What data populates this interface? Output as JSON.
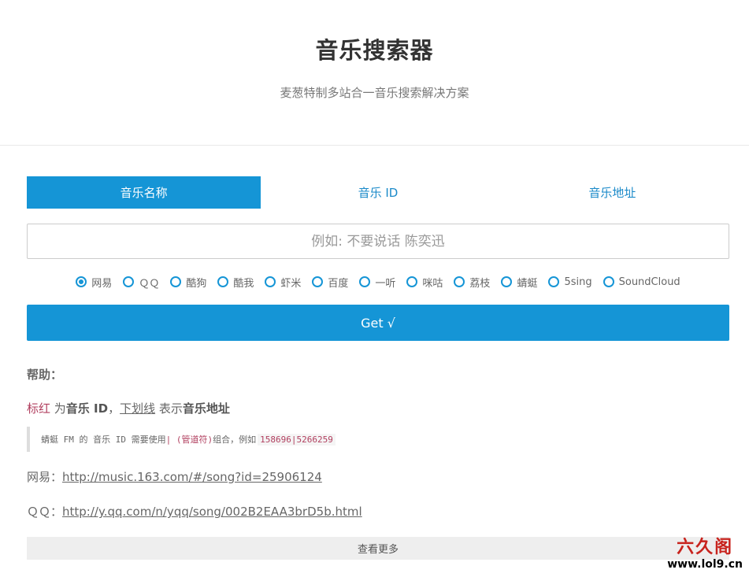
{
  "header": {
    "title": "音乐搜索器",
    "subtitle": "麦葱特制多站合一音乐搜索解决方案"
  },
  "tabs": [
    {
      "label": "音乐名称",
      "active": true
    },
    {
      "label": "音乐 ID",
      "active": false
    },
    {
      "label": "音乐地址",
      "active": false
    }
  ],
  "search": {
    "placeholder": "例如: 不要说话 陈奕迅",
    "value": ""
  },
  "sources": [
    {
      "label": "网易",
      "checked": true
    },
    {
      "label": "ＱＱ",
      "checked": false
    },
    {
      "label": "酷狗",
      "checked": false
    },
    {
      "label": "酷我",
      "checked": false
    },
    {
      "label": "虾米",
      "checked": false
    },
    {
      "label": "百度",
      "checked": false
    },
    {
      "label": "一听",
      "checked": false
    },
    {
      "label": "咪咕",
      "checked": false
    },
    {
      "label": "荔枝",
      "checked": false
    },
    {
      "label": "蜻蜓",
      "checked": false
    },
    {
      "label": "5sing",
      "checked": false
    },
    {
      "label": "SoundCloud",
      "checked": false
    }
  ],
  "get_button": "Get √",
  "help": {
    "title": "帮助：",
    "legend": {
      "red_word": "标红",
      "text_1": " 为",
      "bold_1": "音乐 ID",
      "text_2": "，",
      "underline_word": "下划线",
      "text_3": " 表示",
      "bold_2": "音乐地址"
    },
    "note": {
      "text_1": "蜻蜓 FM 的 音乐 ID 需要使用 ",
      "pipe": "| (管道符)",
      "text_2": " 组合，例如",
      "code": "158696|5266259"
    },
    "examples": [
      {
        "label": "网易：",
        "url_prefix": "http://music.163.com/#/song?id=",
        "url_id": "25906124"
      },
      {
        "label": "ＱＱ：",
        "url_prefix": "http://y.qq.com/n/yqq/song/",
        "url_id": "002B2EAA3brD5b",
        "url_suffix": ".html"
      }
    ]
  },
  "more_button": "查看更多",
  "watermark": {
    "brand": "六久阁",
    "url": "www.lol9.cn"
  },
  "colors": {
    "accent": "#1595d6",
    "highlight_red": "#b13f5f",
    "watermark_red": "#c8231d"
  }
}
